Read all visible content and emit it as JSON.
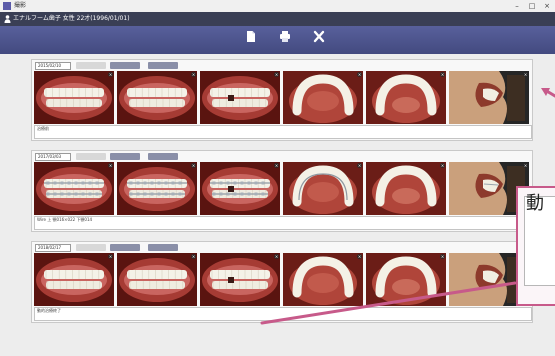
{
  "window": {
    "title": "撮影",
    "buttons": {
      "minimize": "–",
      "maximize": "□",
      "close": "×"
    }
  },
  "patient": {
    "text": "エナルフーム歯子 女性 22才(1996/01/01)"
  },
  "toolbar": {
    "items": [
      {
        "name": "new",
        "label": ""
      },
      {
        "name": "print",
        "label": ""
      },
      {
        "name": "close",
        "label": ""
      }
    ]
  },
  "sessions": [
    {
      "date": "2015/02/10",
      "buttons": {
        "disabled": "",
        "action_a": "",
        "action_b": ""
      },
      "note": "治療前",
      "photos": [
        {
          "view": "frontal-open",
          "braces": false
        },
        {
          "view": "frontal",
          "braces": false
        },
        {
          "view": "frontal-side",
          "braces": false
        },
        {
          "view": "upper-occlusal",
          "braces": false
        },
        {
          "view": "lower-occlusal",
          "braces": false
        },
        {
          "view": "profile",
          "braces": false
        }
      ]
    },
    {
      "date": "2017/03/03",
      "buttons": {
        "disabled": "",
        "action_a": "",
        "action_b": ""
      },
      "note": "Wire 上 顎016×022 下顎014",
      "photos": [
        {
          "view": "frontal-open",
          "braces": true
        },
        {
          "view": "frontal",
          "braces": true
        },
        {
          "view": "frontal-side",
          "braces": true
        },
        {
          "view": "upper-occlusal",
          "braces": true
        },
        {
          "view": "lower-occlusal",
          "braces": false
        },
        {
          "view": "profile",
          "braces": true
        }
      ]
    },
    {
      "date": "2018/02/17",
      "buttons": {
        "disabled": "",
        "action_a": "",
        "action_b": ""
      },
      "note": "動的治療終了",
      "photos": [
        {
          "view": "frontal-open",
          "braces": false
        },
        {
          "view": "frontal",
          "braces": false
        },
        {
          "view": "frontal-side",
          "braces": false
        },
        {
          "view": "upper-occlusal",
          "braces": false
        },
        {
          "view": "lower-occlusal",
          "braces": false
        },
        {
          "view": "profile",
          "braces": false
        }
      ]
    }
  ],
  "callout": {
    "text": "動"
  },
  "colors": {
    "toolbar": "#4b5288",
    "patient_bar": "#3a3f55",
    "accent_arrow": "#c75a8a"
  }
}
